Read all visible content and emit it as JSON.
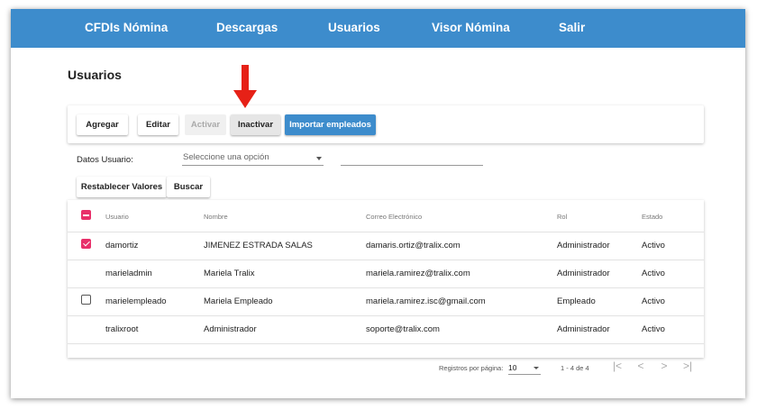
{
  "nav": {
    "items": [
      "CFDIs Nómina",
      "Descargas",
      "Usuarios",
      "Visor Nómina",
      "Salir"
    ]
  },
  "page": {
    "title": "Usuarios"
  },
  "toolbar": {
    "agregar": "Agregar",
    "editar": "Editar",
    "activar": "Activar",
    "inactivar": "Inactivar",
    "importar": "Importar empleados"
  },
  "filter": {
    "label": "Datos Usuario:",
    "select_placeholder": "Seleccione una opción",
    "search_value": ""
  },
  "actions": {
    "reset": "Restablecer Valores",
    "search": "Buscar"
  },
  "table": {
    "headers": [
      "Usuario",
      "Nombre",
      "Correo Electrónico",
      "Rol",
      "Estado"
    ],
    "header_checkbox": "indeterminate",
    "rows": [
      {
        "checkbox": "checked",
        "usuario": "damortiz",
        "nombre": "JIMENEZ ESTRADA SALAS",
        "correo": "damaris.ortiz@tralix.com",
        "rol": "Administrador",
        "estado": "Activo"
      },
      {
        "checkbox": "none",
        "usuario": "marieladmin",
        "nombre": "Mariela Tralix",
        "correo": "mariela.ramirez@tralix.com",
        "rol": "Administrador",
        "estado": "Activo"
      },
      {
        "checkbox": "empty",
        "usuario": "marielempleado",
        "nombre": "Mariela Empleado",
        "correo": "mariela.ramirez.isc@gmail.com",
        "rol": "Empleado",
        "estado": "Activo"
      },
      {
        "checkbox": "none",
        "usuario": "tralixroot",
        "nombre": "Administrador",
        "correo": "soporte@tralix.com",
        "rol": "Administrador",
        "estado": "Activo"
      }
    ]
  },
  "paginator": {
    "label": "Registros por página:",
    "page_size": "10",
    "range": "1 - 4 de 4",
    "first": "|<",
    "prev": "<",
    "next": ">",
    "last": ">|"
  },
  "colors": {
    "navbar": "#3d8ccc",
    "primary_button": "#3d8ccc",
    "checkbox_accent": "#e8306a",
    "annotation_arrow": "#e62117"
  },
  "annotation": {
    "icon": "arrow-down-icon",
    "target": "inactivar-button"
  }
}
